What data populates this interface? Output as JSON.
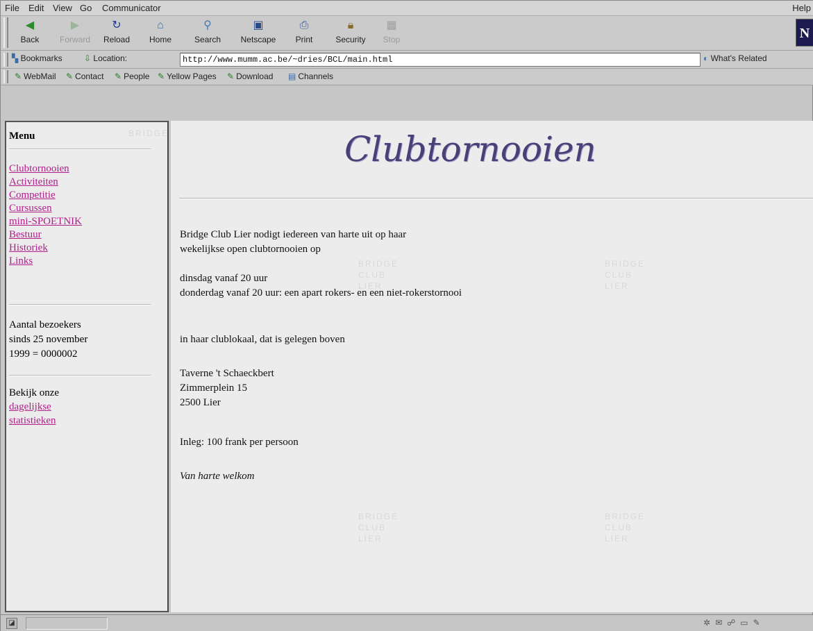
{
  "menubar": {
    "items": [
      "File",
      "Edit",
      "View",
      "Go",
      "Communicator"
    ],
    "help": "Help"
  },
  "toolbar": {
    "buttons": [
      {
        "label": "Back",
        "icon": "back-arrow-icon",
        "enabled": true
      },
      {
        "label": "Forward",
        "icon": "forward-arrow-icon",
        "enabled": false
      },
      {
        "label": "Reload",
        "icon": "reload-icon",
        "enabled": true
      },
      {
        "label": "Home",
        "icon": "home-icon",
        "enabled": true
      },
      {
        "label": "Search",
        "icon": "search-icon",
        "enabled": true
      },
      {
        "label": "Netscape",
        "icon": "netscape-icon",
        "enabled": true
      },
      {
        "label": "Print",
        "icon": "print-icon",
        "enabled": true
      },
      {
        "label": "Security",
        "icon": "security-icon",
        "enabled": true
      },
      {
        "label": "Stop",
        "icon": "stop-icon",
        "enabled": false
      }
    ],
    "logo": "N"
  },
  "location": {
    "bookmarks_label": "Bookmarks",
    "location_label": "Location:",
    "url": "http://www.mumm.ac.be/~dries/BCL/main.html",
    "whats_related": "What's Related"
  },
  "personal_toolbar": [
    "WebMail",
    "Contact",
    "People",
    "Yellow Pages",
    "Download",
    "Channels"
  ],
  "sidebar": {
    "title": "Menu",
    "links": [
      "Clubtornooien",
      "Activiteiten",
      "Competitie",
      "Cursussen",
      "mini-SPOETNIK",
      "Bestuur",
      "Historiek",
      "Links"
    ],
    "visitors_lines": [
      "Aantal bezoekers",
      "sinds 25 november",
      "1999 = 0000002"
    ],
    "stats_intro": "Bekijk onze",
    "stats_link_1": "dagelijkse",
    "stats_link_2": "statistieken"
  },
  "main": {
    "heading": "Clubtornooien",
    "intro_1": "Bridge Club Lier nodigt iedereen van harte uit op haar",
    "intro_2": "wekelijkse open clubtornooien op",
    "day_1": "dinsdag vanaf 20 uur",
    "day_2": "donderdag vanaf 20 uur: een apart rokers- en een niet-rokerstornooi",
    "location_intro": "in haar clublokaal, dat is gelegen boven",
    "address_1": "Taverne 't Schaeckbert",
    "address_2": "Zimmerplein 15",
    "address_3": "2500 Lier",
    "fee": "Inleg: 100 frank per persoon",
    "welcome": "Van harte welkom"
  },
  "watermark": {
    "line_1": "BRIDGE",
    "line_2": "CLUB",
    "line_3": "LIER"
  }
}
